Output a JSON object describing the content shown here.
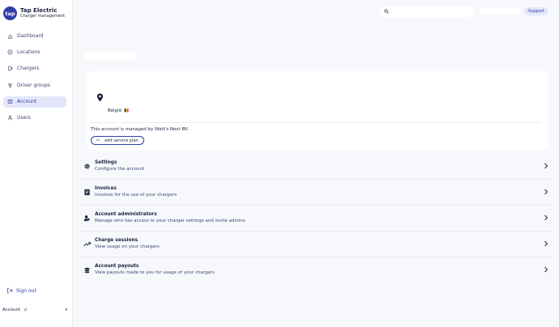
{
  "brand": {
    "logo_text": "tap",
    "name": "Tap Electric",
    "subtitle": "Charger management"
  },
  "sidebar": {
    "items": [
      {
        "label": "Dashboard",
        "icon": "bar-chart-icon",
        "active": false
      },
      {
        "label": "Locations",
        "icon": "location-icon",
        "active": false
      },
      {
        "label": "Chargers",
        "icon": "charger-icon",
        "active": false
      },
      {
        "label": "Driver groups",
        "icon": "group-icon",
        "active": false
      },
      {
        "label": "Account",
        "icon": "account-icon",
        "active": true
      },
      {
        "label": "Users",
        "icon": "user-icon",
        "active": false
      }
    ],
    "sign_out": "Sign out",
    "account_footer": "Account"
  },
  "topbar": {
    "search_placeholder": "",
    "support_label": "Support"
  },
  "account_card": {
    "country": "België",
    "managed_text": "This account is managed by Watt's Next BV.",
    "edit_button": "edit service plan"
  },
  "menu": [
    {
      "title": "Settings",
      "subtitle": "Configure the account",
      "icon": "gear-icon"
    },
    {
      "title": "Invoices",
      "subtitle": "Invoices for the use of your chargers",
      "icon": "invoice-icon"
    },
    {
      "title": "Account administrators",
      "subtitle": "Manage who has access to your charger settings and invite admins",
      "icon": "admin-icon"
    },
    {
      "title": "Charge sessions",
      "subtitle": "View usage on your chargers",
      "icon": "trending-up-icon"
    },
    {
      "title": "Account payouts",
      "subtitle": "View payouts made to you for usage of your chargers",
      "icon": "coins-icon"
    }
  ],
  "colors": {
    "accent": "#2f3da8",
    "active_bg": "#e3e6f8",
    "page_bg": "#f6f8fc"
  }
}
